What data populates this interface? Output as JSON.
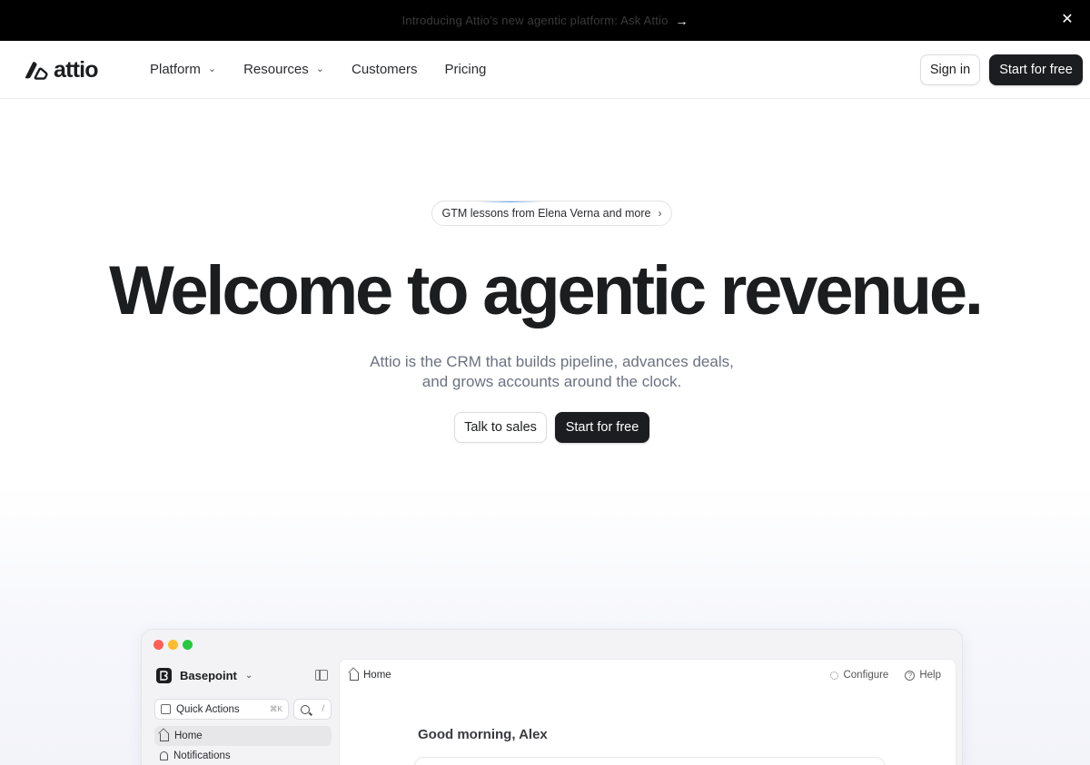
{
  "announcement": {
    "text": "Introducing Attio's new agentic platform: Ask Attio",
    "arrow": "→",
    "close": "✕"
  },
  "nav": {
    "logo_text": "attio",
    "links": [
      {
        "label": "Platform",
        "has_dropdown": true
      },
      {
        "label": "Resources",
        "has_dropdown": true
      },
      {
        "label": "Customers",
        "has_dropdown": false
      },
      {
        "label": "Pricing",
        "has_dropdown": false
      }
    ],
    "signin_label": "Sign in",
    "start_label": "Start for free"
  },
  "hero": {
    "pill_text": "GTM lessons from Elena Verna and more",
    "pill_chevron": "›",
    "headline": "Welcome to agentic revenue.",
    "subtitle": "Attio is the CRM that builds pipeline, advances deals, and grows accounts around the clock.",
    "talk_label": "Talk to sales",
    "start_label": "Start for free"
  },
  "app": {
    "workspace": "Basepoint",
    "quick_actions": "Quick Actions",
    "quick_actions_kbd": "⌘K",
    "search_kbd": "/",
    "sidebar": [
      {
        "label": "Home",
        "active": true
      },
      {
        "label": "Notifications",
        "active": false
      }
    ],
    "breadcrumb": "Home",
    "configure": "Configure",
    "help": "Help",
    "greeting": "Good morning, Alex"
  },
  "colors": {
    "dark_button": "#1c1d20",
    "announcement_bg": "#000000",
    "subtitle_text": "#6b7280",
    "traffic_red": "#fe5f57",
    "traffic_yellow": "#febc2e",
    "traffic_green": "#28c840"
  }
}
